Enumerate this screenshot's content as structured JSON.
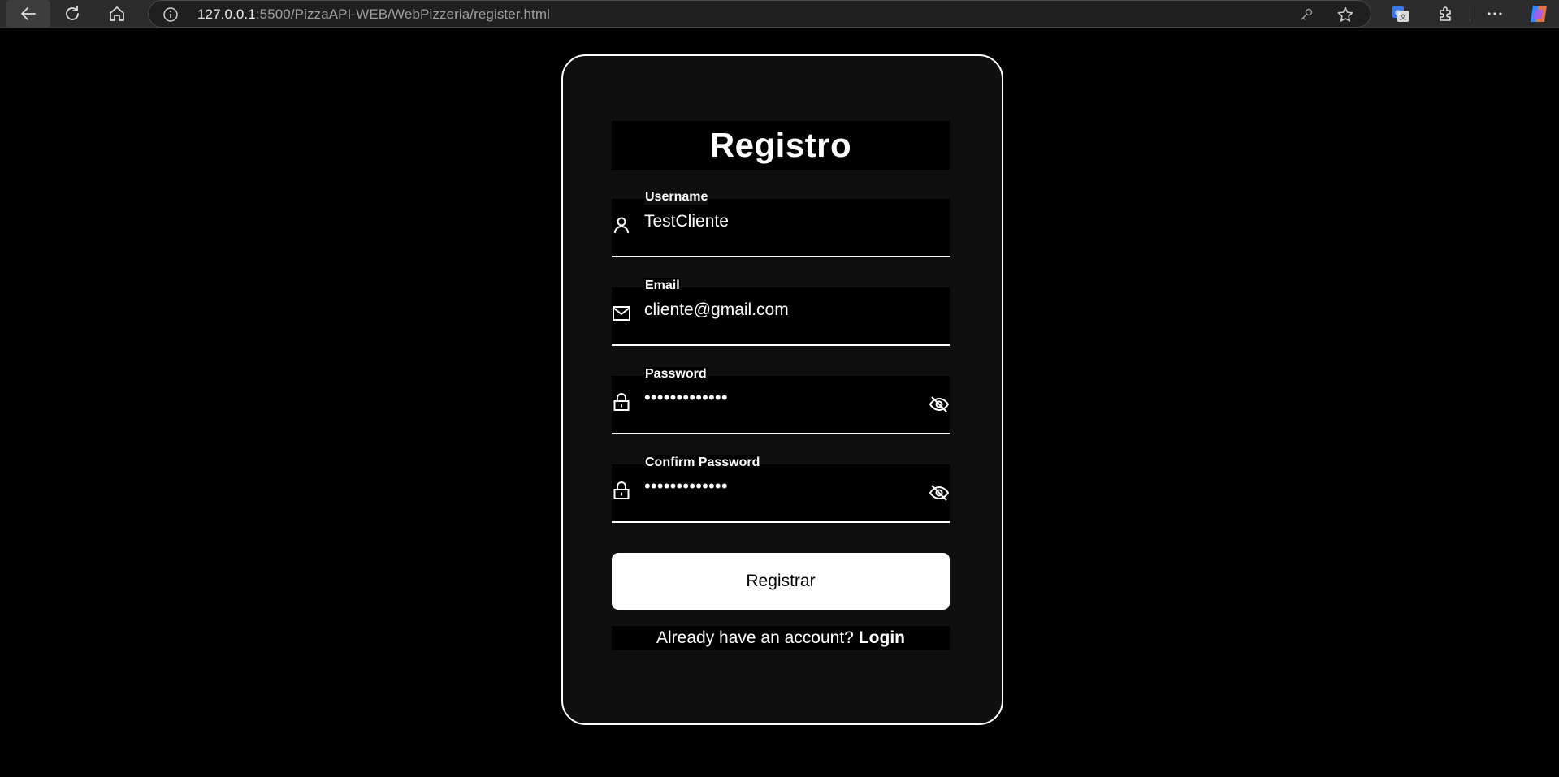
{
  "browser": {
    "url_host": "127.0.0.1",
    "url_rest": ":5500/PizzaAPI-WEB/WebPizzeria/register.html",
    "icons": [
      "back-arrow-icon",
      "refresh-icon",
      "home-icon",
      "info-icon",
      "key-icon",
      "star-icon",
      "translate-icon",
      "extensions-icon",
      "more-icon",
      "copilot-icon"
    ]
  },
  "form": {
    "title": "Registro",
    "fields": [
      {
        "label": "Username",
        "value": "TestCliente",
        "icon": "user-icon"
      },
      {
        "label": "Email",
        "value": "cliente@gmail.com",
        "icon": "mail-icon"
      },
      {
        "label": "Password",
        "value": "•••••••••••••",
        "icon": "lock-icon",
        "toggle_icon": "eye-off-icon"
      },
      {
        "label": "Confirm Password",
        "value": "•••••••••••••",
        "icon": "lock-icon",
        "toggle_icon": "eye-off-icon"
      }
    ],
    "submit_label": "Registrar",
    "footer_text": "Already have an account?",
    "footer_link": "Login"
  },
  "colors": {
    "page_bg": "#000000",
    "card_bg": "#0f0f0f",
    "card_border": "#ffffff",
    "button_bg": "#ffffff",
    "button_text": "#000000"
  }
}
